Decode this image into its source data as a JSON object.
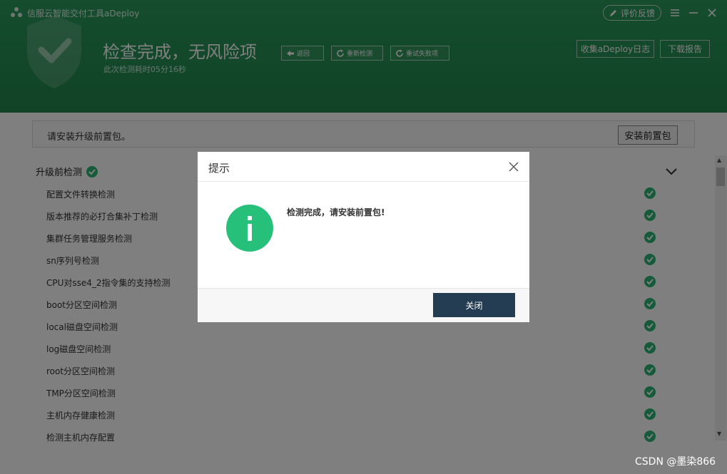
{
  "app": {
    "title": "信服云智能交付工具aDeploy",
    "feedback_label": "评价反馈"
  },
  "header": {
    "status_title": "检查完成，无风险项",
    "duration_text": "此次检测耗时05分16秒",
    "back_label": "返回",
    "recheck_label": "重新检测",
    "retry_label": "重试失败项",
    "collect_log_label": "收集aDeploy日志",
    "download_report_label": "下载报告"
  },
  "notice": {
    "text": "请安装升级前置包。",
    "install_label": "安装前置包"
  },
  "section": {
    "title": "升级前检测",
    "items": [
      "配置文件转换检测",
      "版本推荐的必打合集补丁检测",
      "集群任务管理服务检测",
      "sn序列号检测",
      "CPU对sse4_2指令集的支持检测",
      "boot分区空间检测",
      "local磁盘空间检测",
      "log磁盘空间检测",
      "root分区空间检测",
      "TMP分区空间检测",
      "主机内存健康检测",
      "检测主机内存配置"
    ]
  },
  "dialog": {
    "title": "提示",
    "message": "检测完成，请安装前置包!",
    "close_label": "关闭"
  },
  "watermark": "CSDN @墨染866",
  "colors": {
    "header_green": "#23874e",
    "check_green": "#2bb673",
    "info_green": "#27c07a",
    "button_dark": "#243d52"
  }
}
